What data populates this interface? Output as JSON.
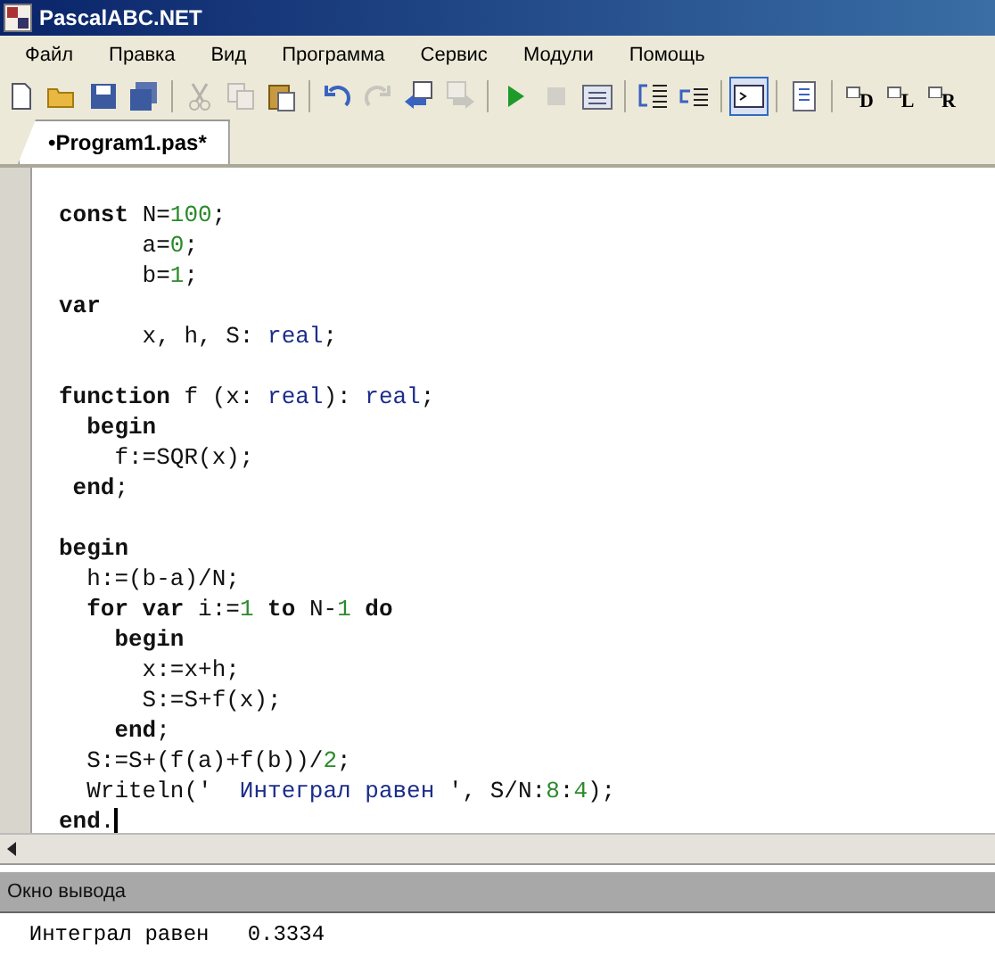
{
  "window": {
    "title": "PascalABC.NET"
  },
  "menu": [
    "Файл",
    "Правка",
    "Вид",
    "Программа",
    "Сервис",
    "Модули",
    "Помощь"
  ],
  "toolbar": [
    {
      "kind": "new",
      "disabled": false,
      "pressed": false
    },
    {
      "kind": "open",
      "disabled": false,
      "pressed": false
    },
    {
      "kind": "save",
      "disabled": false,
      "pressed": false
    },
    {
      "kind": "saveall",
      "disabled": false,
      "pressed": false
    },
    {
      "kind": "sep"
    },
    {
      "kind": "cut",
      "disabled": true,
      "pressed": false
    },
    {
      "kind": "copy",
      "disabled": true,
      "pressed": false
    },
    {
      "kind": "paste",
      "disabled": false,
      "pressed": false
    },
    {
      "kind": "sep"
    },
    {
      "kind": "undo",
      "disabled": false,
      "pressed": false
    },
    {
      "kind": "redo",
      "disabled": true,
      "pressed": false
    },
    {
      "kind": "back",
      "disabled": false,
      "pressed": false
    },
    {
      "kind": "forward",
      "disabled": true,
      "pressed": false
    },
    {
      "kind": "sep"
    },
    {
      "kind": "run",
      "disabled": false,
      "pressed": false
    },
    {
      "kind": "stop",
      "disabled": true,
      "pressed": false
    },
    {
      "kind": "compile",
      "disabled": false,
      "pressed": false
    },
    {
      "kind": "sep"
    },
    {
      "kind": "indent",
      "disabled": false,
      "pressed": false
    },
    {
      "kind": "unindent",
      "disabled": false,
      "pressed": false
    },
    {
      "kind": "sep"
    },
    {
      "kind": "console",
      "disabled": false,
      "pressed": true
    },
    {
      "kind": "sep"
    },
    {
      "kind": "doc",
      "disabled": false,
      "pressed": false
    },
    {
      "kind": "sep"
    },
    {
      "kind": "lettered",
      "label": "D",
      "disabled": false,
      "pressed": false
    },
    {
      "kind": "lettered",
      "label": "L",
      "disabled": false,
      "pressed": false
    },
    {
      "kind": "lettered",
      "label": "R",
      "disabled": false,
      "pressed": false
    }
  ],
  "tabs": [
    {
      "label": "•Program1.pas*",
      "selected": true
    }
  ],
  "editor": {
    "lines": [
      {
        "caret": false,
        "tokens": [
          {
            "kind": "kw",
            "t": "const"
          },
          {
            "kind": "plain",
            "t": " N="
          },
          {
            "kind": "num",
            "t": "100"
          },
          {
            "kind": "plain",
            "t": ";"
          }
        ]
      },
      {
        "caret": false,
        "tokens": [
          {
            "kind": "plain",
            "t": "      a="
          },
          {
            "kind": "num",
            "t": "0"
          },
          {
            "kind": "plain",
            "t": ";"
          }
        ]
      },
      {
        "caret": false,
        "tokens": [
          {
            "kind": "plain",
            "t": "      b="
          },
          {
            "kind": "num",
            "t": "1"
          },
          {
            "kind": "plain",
            "t": ";"
          }
        ]
      },
      {
        "caret": false,
        "tokens": [
          {
            "kind": "kw",
            "t": "var"
          }
        ]
      },
      {
        "caret": false,
        "tokens": [
          {
            "kind": "plain",
            "t": "      x, h, S: "
          },
          {
            "kind": "type",
            "t": "real"
          },
          {
            "kind": "plain",
            "t": ";"
          }
        ]
      },
      {
        "caret": false
      },
      {
        "caret": false,
        "tokens": [
          {
            "kind": "kw",
            "t": "function"
          },
          {
            "kind": "plain",
            "t": " f (x: "
          },
          {
            "kind": "type",
            "t": "real"
          },
          {
            "kind": "plain",
            "t": "): "
          },
          {
            "kind": "type",
            "t": "real"
          },
          {
            "kind": "plain",
            "t": ";"
          }
        ]
      },
      {
        "caret": false,
        "tokens": [
          {
            "kind": "kw",
            "t": "  begin"
          }
        ]
      },
      {
        "caret": false,
        "tokens": [
          {
            "kind": "plain",
            "t": "    f:=SQR(x);"
          }
        ]
      },
      {
        "caret": false,
        "tokens": [
          {
            "kind": "kw",
            "t": " end"
          },
          {
            "kind": "plain",
            "t": ";"
          }
        ]
      },
      {
        "caret": false
      },
      {
        "caret": false,
        "tokens": [
          {
            "kind": "kw",
            "t": "begin"
          }
        ]
      },
      {
        "caret": false,
        "tokens": [
          {
            "kind": "plain",
            "t": "  h:=(b-a)/N;"
          }
        ]
      },
      {
        "caret": false,
        "tokens": [
          {
            "kind": "kw",
            "t": "  for var"
          },
          {
            "kind": "plain",
            "t": " i:="
          },
          {
            "kind": "num",
            "t": "1"
          },
          {
            "kind": "kw",
            "t": " to"
          },
          {
            "kind": "plain",
            "t": " N-"
          },
          {
            "kind": "num",
            "t": "1"
          },
          {
            "kind": "kw",
            "t": " do"
          }
        ]
      },
      {
        "caret": false,
        "tokens": [
          {
            "kind": "kw",
            "t": "    begin"
          }
        ]
      },
      {
        "caret": false,
        "tokens": [
          {
            "kind": "plain",
            "t": "      x:=x+h;"
          }
        ]
      },
      {
        "caret": false,
        "tokens": [
          {
            "kind": "plain",
            "t": "      S:=S+f(x);"
          }
        ]
      },
      {
        "caret": false,
        "tokens": [
          {
            "kind": "kw",
            "t": "    end"
          },
          {
            "kind": "plain",
            "t": ";"
          }
        ]
      },
      {
        "caret": false,
        "tokens": [
          {
            "kind": "plain",
            "t": "  S:=S+(f(a)+f(b))/"
          },
          {
            "kind": "num",
            "t": "2"
          },
          {
            "kind": "plain",
            "t": ";"
          }
        ]
      },
      {
        "caret": false,
        "tokens": [
          {
            "kind": "plain",
            "t": "  Writeln('"
          },
          {
            "kind": "str",
            "t": "  Интеграл равен "
          },
          {
            "kind": "plain",
            "t": "', S/N:"
          },
          {
            "kind": "num",
            "t": "8"
          },
          {
            "kind": "plain",
            "t": ":"
          },
          {
            "kind": "num",
            "t": "4"
          },
          {
            "kind": "plain",
            "t": ");"
          }
        ]
      },
      {
        "caret": true,
        "tokens": [
          {
            "kind": "kw",
            "t": "end"
          },
          {
            "kind": "plain",
            "t": "."
          }
        ]
      }
    ]
  },
  "output": {
    "title": "Окно вывода",
    "text": "  Интеграл равен   0.3334"
  }
}
